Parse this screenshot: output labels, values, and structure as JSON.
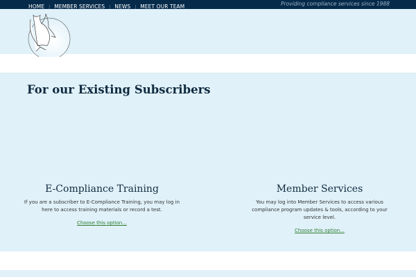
{
  "nav": {
    "items": [
      "HOME",
      "MEMBER SERVICES",
      "NEWS",
      "MEET OUR TEAM"
    ],
    "tagline": "Providing compliance services since 1988"
  },
  "main": {
    "title": "For our Existing Subscribers",
    "options": [
      {
        "title": "E-Compliance Training",
        "text": "If you are a subscriber to E-Compliance Training, you may log in here to access training materials or record a test.",
        "link": "Choose this option..."
      },
      {
        "title": "Member Services",
        "text": "You may log into Member Services to access various compliance program updates & tools, according to your service level.",
        "link": "Choose this option..."
      }
    ]
  }
}
